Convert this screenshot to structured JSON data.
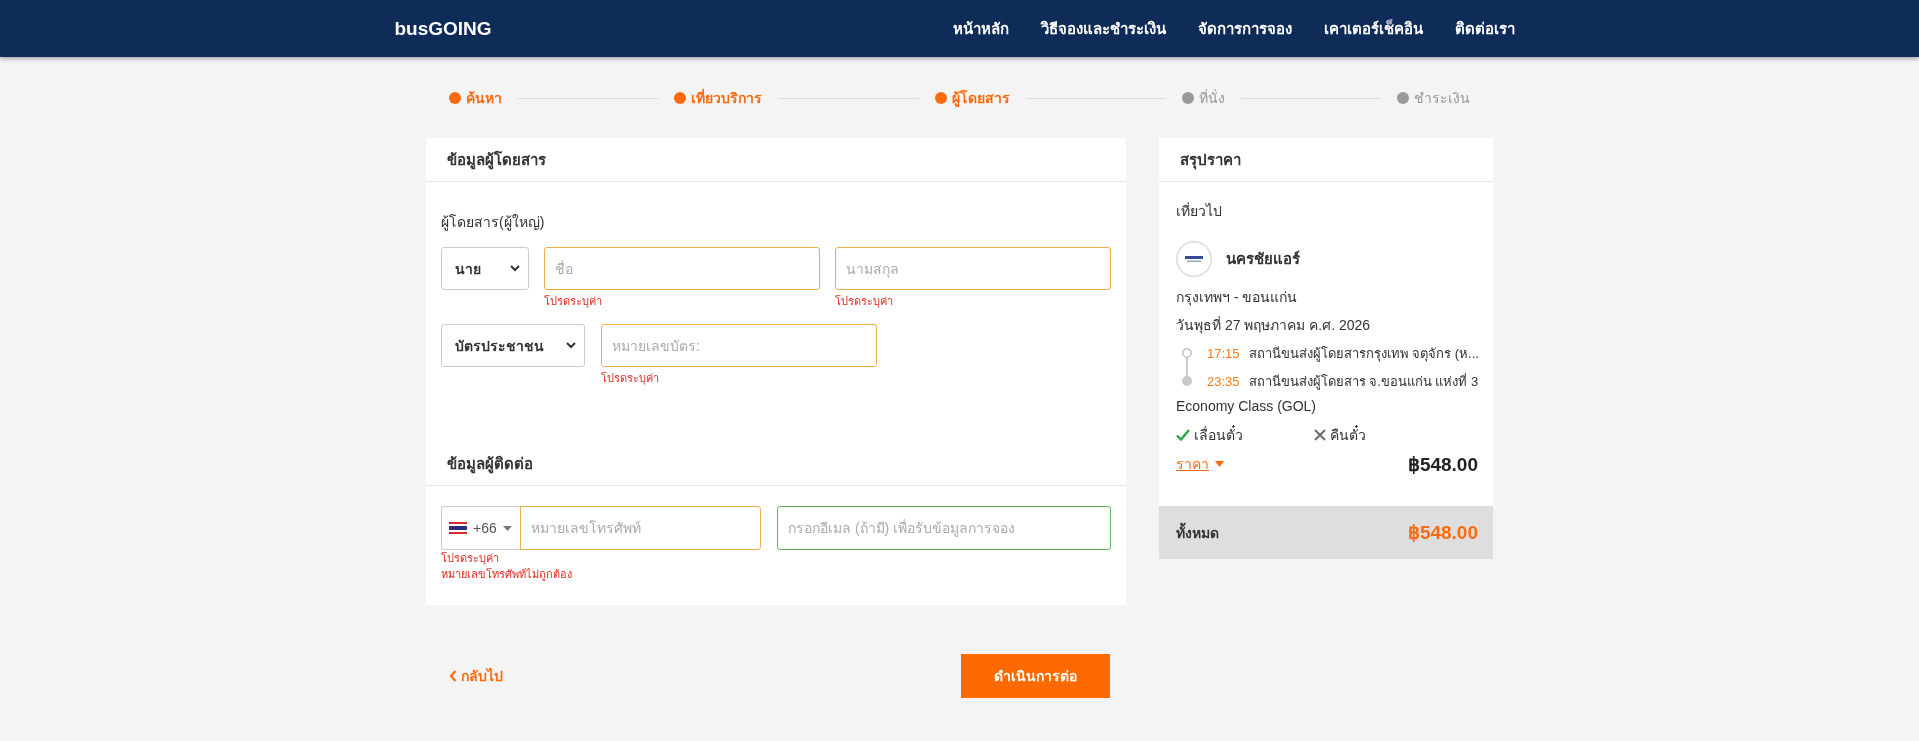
{
  "header": {
    "logo": "busGOING",
    "nav": [
      "หน้าหลัก",
      "วิธีจองและชำระเงิน",
      "จัดการการจอง",
      "เคาเตอร์เช็คอิน",
      "ติดต่อเรา"
    ]
  },
  "stepper": [
    {
      "label": "ค้นหา",
      "done": true
    },
    {
      "label": "เที่ยวบริการ",
      "done": true
    },
    {
      "label": "ผู้โดยสาร",
      "done": true
    },
    {
      "label": "ที่นั่ง",
      "done": false
    },
    {
      "label": "ชำระเงิน",
      "done": false
    }
  ],
  "passenger": {
    "title": "ข้อมูลผู้โดยสาร",
    "group_label": "ผู้โดยสาร(ผู้ใหญ่)",
    "title_select": "นาย",
    "first_name": {
      "placeholder": "ชื่อ",
      "invalid": true,
      "error": "โปรดระบุค่า"
    },
    "last_name": {
      "placeholder": "นามสกุล",
      "invalid": true,
      "error": "โปรดระบุค่า"
    },
    "id_type_select": "บัตรประชาชน",
    "id_number": {
      "placeholder": "หมายเลขบัตร:",
      "invalid": true,
      "error": "โปรดระบุค่า"
    }
  },
  "contact": {
    "title": "ข้อมูลผู้ติดต่อ",
    "country_code": "+66",
    "phone": {
      "placeholder": "หมายเลขโทรศัพท์",
      "invalid": true,
      "errors": [
        "โปรดระบุค่า",
        "หมายเลขโทรศัพท์ไม่ถูกต้อง"
      ]
    },
    "email": {
      "placeholder": "กรอกอีเมล (ถ้ามี) เพื่อรับข้อมูลการจอง",
      "invalid": false
    }
  },
  "actions": {
    "back": "กลับไป",
    "continue": "ดำเนินการต่อ"
  },
  "summary": {
    "title": "สรุปราคา",
    "trip_label": "เที่ยวไป",
    "operator": "นครชัยแอร์",
    "route": "กรุงเทพฯ - ขอนแก่น",
    "date": "วันพุธที่ 27 พฤษภาคม ค.ศ. 2026",
    "stops": [
      {
        "time": "17:15",
        "station": "สถานีขนส่งผู้โดยสารกรุงเทพ จตุจักร (ห..."
      },
      {
        "time": "23:35",
        "station": "สถานีขนส่งผู้โดยสาร จ.ขอนแก่น แห่งที่ 3"
      }
    ],
    "seat_class": "Economy Class (GOL)",
    "policies": [
      {
        "label": "เลื่อนตั๋ว",
        "allowed": true
      },
      {
        "label": "คืนตั๋ว",
        "allowed": false
      }
    ],
    "price_label": "ราคา",
    "price_expanded": false,
    "price": "฿548.00",
    "total_label": "ทั้งหมด",
    "total": "฿548.00"
  }
}
